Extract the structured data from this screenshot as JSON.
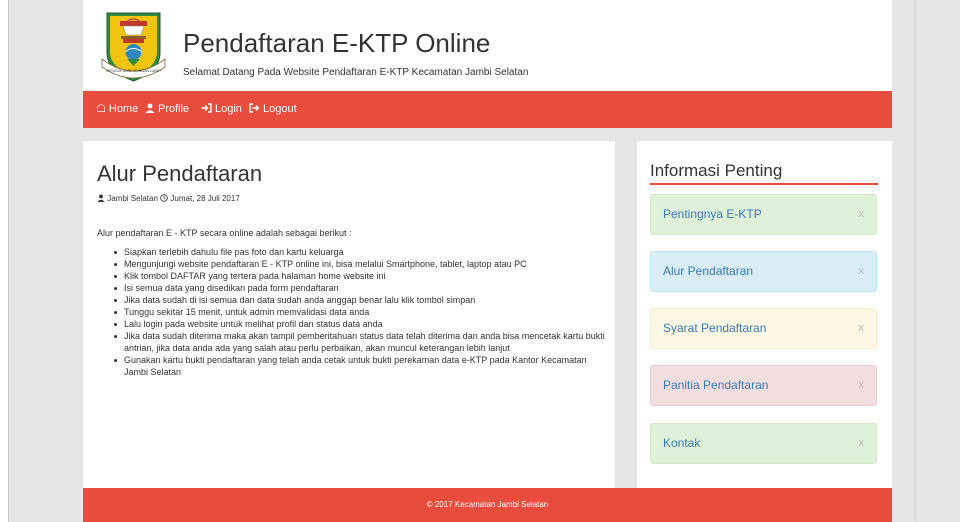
{
  "header": {
    "title": "Pendaftaran E-KTP Online",
    "subtitle": "Selamat Datang Pada Website Pendaftaran E-KTP Kecamatan Jambi Selatan"
  },
  "nav": [
    {
      "label": "Home",
      "icon": "home-icon"
    },
    {
      "label": "Profile",
      "icon": "user-icon"
    },
    {
      "label": "Login",
      "icon": "login-icon"
    },
    {
      "label": "Logout",
      "icon": "logout-icon"
    }
  ],
  "post": {
    "title": "Alur Pendaftaran",
    "author": "Jambi Selatan",
    "date": "Jumat, 28 Juli 2017",
    "intro": "Alur pendaftaran E - KTP secara online adalah sebagai berikut :",
    "steps": [
      "Siapkan terlebih dahulu file pas foto dan kartu keluarga",
      "Mengunjungi website pendaftaran E - KTP online ini, bisa melalui Smartphone, tablet, laptop atau PC",
      "Klik tombol DAFTAR yang tertera pada halaman home website ini",
      "Isi semua data yang disedikan pada form pendaftaran",
      "Jika data sudah di isi semua dan data sudah anda anggap benar lalu klik tombol simpan",
      "Tunggu sekitar 15 menit, untuk admin memvalidasi data anda",
      "Lalu login pada website untuk melihat profil dan status data anda",
      "Jika data sudah diterima maka akan tampil pemberitahuan status data telah diterima dan anda bisa mencetak kartu bukti antrian, jika data anda ada yang salah atau perlu perbaikan, akan muncul keterangan lebih lanjut",
      "Gunakan kartu bukti pendaftaran yang telah anda cetak untuk bukti perekaman data e-KTP pada Kantor Kecamatan Jambi Selatan"
    ]
  },
  "sidebar": {
    "title": "Informasi Penting",
    "close_glyph": "x",
    "items": [
      {
        "label": "Pentingnya E-KTP",
        "style": "green"
      },
      {
        "label": "Alur Pendaftaran",
        "style": "blue"
      },
      {
        "label": "Syarat Pendaftaran",
        "style": "yellow"
      },
      {
        "label": "Panitia Pendaftaran",
        "style": "red"
      },
      {
        "label": "Kontak",
        "style": "green"
      }
    ]
  },
  "logo": {
    "text": "SEPUCUK JAMBI SEMBILAN LURAH"
  },
  "footer": {
    "text": "© 2017 Kecamatan Jambi Selatan"
  },
  "colors": {
    "accent": "#e74c3c",
    "page_bg": "#e5e5e5"
  }
}
